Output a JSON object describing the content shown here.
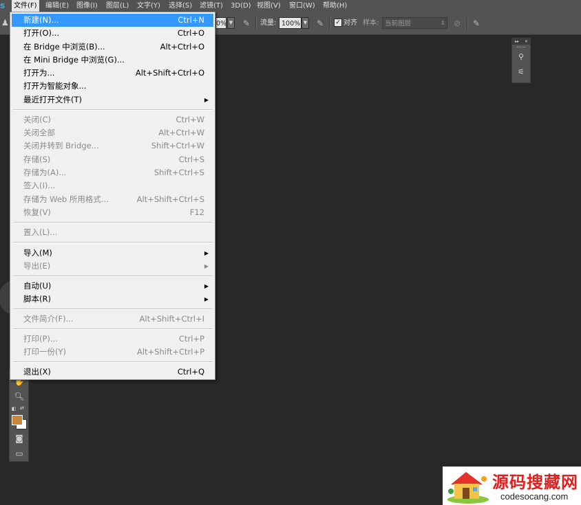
{
  "menubar": {
    "app_logo": "s",
    "items": [
      {
        "label": "文件(F)",
        "active": true
      },
      {
        "label": "编辑(E)"
      },
      {
        "label": "图像(I)"
      },
      {
        "label": "图层(L)"
      },
      {
        "label": "文字(Y)"
      },
      {
        "label": "选择(S)"
      },
      {
        "label": "滤镜(T)"
      },
      {
        "label": "3D(D)"
      },
      {
        "label": "视图(V)"
      },
      {
        "label": "窗口(W)"
      },
      {
        "label": "帮助(H)"
      }
    ]
  },
  "options_bar": {
    "opacity_value": "0%",
    "flow_label": "流量:",
    "flow_value": "100%",
    "align_label": "对齐",
    "align_checked": true,
    "sample_label": "样本:",
    "sample_value": "当前图层"
  },
  "file_menu": {
    "items": [
      {
        "label": "新建(N)...",
        "shortcut": "Ctrl+N",
        "state": "highlighted"
      },
      {
        "label": "打开(O)...",
        "shortcut": "Ctrl+O",
        "state": "enabled"
      },
      {
        "label": "在 Bridge 中浏览(B)...",
        "shortcut": "Alt+Ctrl+O",
        "state": "enabled"
      },
      {
        "label": "在 Mini Bridge 中浏览(G)...",
        "shortcut": "",
        "state": "enabled"
      },
      {
        "label": "打开为...",
        "shortcut": "Alt+Shift+Ctrl+O",
        "state": "enabled"
      },
      {
        "label": "打开为智能对象...",
        "shortcut": "",
        "state": "enabled"
      },
      {
        "label": "最近打开文件(T)",
        "shortcut": "",
        "state": "enabled",
        "submenu": true
      },
      {
        "label": "关闭(C)",
        "shortcut": "Ctrl+W",
        "state": "disabled"
      },
      {
        "label": "关闭全部",
        "shortcut": "Alt+Ctrl+W",
        "state": "disabled"
      },
      {
        "label": "关闭并转到 Bridge...",
        "shortcut": "Shift+Ctrl+W",
        "state": "disabled"
      },
      {
        "label": "存储(S)",
        "shortcut": "Ctrl+S",
        "state": "disabled"
      },
      {
        "label": "存储为(A)...",
        "shortcut": "Shift+Ctrl+S",
        "state": "disabled"
      },
      {
        "label": "签入(I)...",
        "shortcut": "",
        "state": "disabled"
      },
      {
        "label": "存储为 Web 所用格式...",
        "shortcut": "Alt+Shift+Ctrl+S",
        "state": "disabled"
      },
      {
        "label": "恢复(V)",
        "shortcut": "F12",
        "state": "disabled"
      },
      {
        "label": "置入(L)...",
        "shortcut": "",
        "state": "disabled"
      },
      {
        "label": "导入(M)",
        "shortcut": "",
        "state": "enabled",
        "submenu": true
      },
      {
        "label": "导出(E)",
        "shortcut": "",
        "state": "disabled",
        "submenu": true
      },
      {
        "label": "自动(U)",
        "shortcut": "",
        "state": "enabled",
        "submenu": true
      },
      {
        "label": "脚本(R)",
        "shortcut": "",
        "state": "enabled",
        "submenu": true
      },
      {
        "label": "文件简介(F)...",
        "shortcut": "Alt+Shift+Ctrl+I",
        "state": "disabled"
      },
      {
        "label": "打印(P)...",
        "shortcut": "Ctrl+P",
        "state": "disabled"
      },
      {
        "label": "打印一份(Y)",
        "shortcut": "Alt+Shift+Ctrl+P",
        "state": "disabled"
      },
      {
        "label": "退出(X)",
        "shortcut": "Ctrl+Q",
        "state": "enabled"
      }
    ],
    "submenu_arrow": "▶"
  },
  "toolbox": {
    "foreground_color": "#c8883a",
    "background_color": "#ffffff",
    "icons": [
      "hand-icon",
      "zoom-icon",
      "swap-colors-icon",
      "quick-mask-icon",
      "screen-mode-icon"
    ]
  },
  "panel": {
    "icons": [
      "brush-presets-icon",
      "clone-source-icon"
    ]
  },
  "watermark": {
    "title": "源码搜藏网",
    "url": "codesocang.com"
  },
  "colors": {
    "workspace": "#282828",
    "chrome": "#535353",
    "menu_bg": "#f0f0f0",
    "highlight": "#3399ff",
    "disabled_text": "#8a8a8a"
  }
}
